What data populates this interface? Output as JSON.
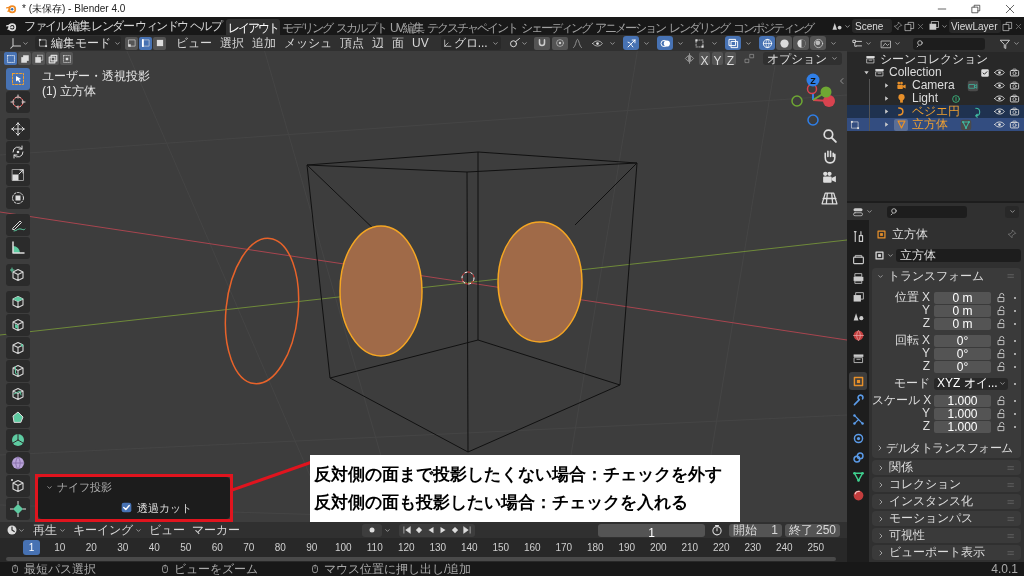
{
  "window": {
    "title": "* (未保存) - Blender 4.0"
  },
  "menu": [
    "ファイル",
    "編集",
    "レンダー",
    "ウィンドウ",
    "ヘルプ"
  ],
  "workspaces": [
    {
      "label": "レイアウト",
      "selected": true
    },
    {
      "label": "モデリング",
      "selected": false
    },
    {
      "label": "スカルプト",
      "selected": false
    },
    {
      "label": "UV編集",
      "selected": false
    },
    {
      "label": "テクスチャペイント",
      "selected": false
    },
    {
      "label": "シェーディング",
      "selected": false
    },
    {
      "label": "アニメーション",
      "selected": false
    },
    {
      "label": "レンダリング",
      "selected": false
    },
    {
      "label": "コンポジティング",
      "selected": false
    }
  ],
  "scene": "Scene",
  "view_layer": "ViewLayer",
  "viewport": {
    "mode": "編集モード",
    "select_modes": [
      {
        "kind": "vertex",
        "selected": false
      },
      {
        "kind": "edge",
        "selected": true
      },
      {
        "kind": "face",
        "selected": false
      }
    ],
    "menus": [
      "ビュー",
      "選択",
      "追加",
      "メッシュ",
      "頂点",
      "辺",
      "面",
      "UV"
    ],
    "orientation": "グロ...",
    "snapping": [
      {
        "kind": "snap",
        "on": false
      },
      {
        "kind": "proportional",
        "on": false
      }
    ],
    "overlays": [
      {
        "kind": "visibility",
        "on": false
      },
      {
        "kind": "gizmo",
        "on": true
      },
      {
        "kind": "overlay",
        "on": true
      },
      {
        "kind": "mesh_overlay",
        "on": false
      },
      {
        "kind": "xray",
        "on": true
      }
    ],
    "shading": [
      {
        "kind": "wireframe",
        "selected": true
      },
      {
        "kind": "solid",
        "selected": false
      },
      {
        "kind": "material",
        "selected": false
      },
      {
        "kind": "rendered",
        "selected": false
      }
    ],
    "box_modes": [
      {
        "kind": "new",
        "selected": true
      },
      {
        "kind": "extend",
        "selected": false
      },
      {
        "kind": "subtract",
        "selected": false
      },
      {
        "kind": "difference",
        "selected": false
      },
      {
        "kind": "intersect",
        "selected": false
      }
    ],
    "mirror_axes": [
      {
        "label": "X",
        "on": false
      },
      {
        "label": "Y",
        "on": false
      },
      {
        "label": "Z",
        "on": false
      }
    ],
    "options": "オプション",
    "view_name": "ユーザー・透視投影",
    "object_info": "(1) 立方体",
    "gizmo_label": "Z",
    "tools": [
      {
        "kind": "select",
        "selected": true
      },
      {
        "kind": "cursor",
        "selected": false
      },
      {
        "kind": "move",
        "selected": false
      },
      {
        "kind": "rotate",
        "selected": false
      },
      {
        "kind": "scale",
        "selected": false
      },
      {
        "kind": "transform",
        "selected": false
      },
      {
        "kind": "annotate",
        "selected": false
      },
      {
        "kind": "measure",
        "selected": false
      },
      {
        "kind": "add_cube",
        "selected": false
      },
      {
        "kind": "extrude",
        "selected": false
      },
      {
        "kind": "inset",
        "selected": false
      },
      {
        "kind": "bevel",
        "selected": false
      },
      {
        "kind": "loop_cut",
        "selected": false
      },
      {
        "kind": "knife",
        "selected": false
      },
      {
        "kind": "poly_build",
        "selected": false
      },
      {
        "kind": "spin",
        "selected": false
      },
      {
        "kind": "smooth",
        "selected": false
      },
      {
        "kind": "edge_slide",
        "selected": false
      },
      {
        "kind": "shrink",
        "selected": false
      }
    ]
  },
  "operator_panel": {
    "title": "ナイフ投影",
    "options": [
      {
        "label": "透過カット",
        "checked": true
      }
    ]
  },
  "annotation": [
    "反対側の面まで投影したくない場合：チェックを外す",
    "反対側の面も投影したい場合：チェックを入れる"
  ],
  "outliner": {
    "root": "シーンコレクション",
    "items": [
      {
        "label": "Collection",
        "kind": "collection",
        "expanded": true,
        "checked": true,
        "children": [
          {
            "label": "Camera",
            "kind": "camera",
            "selected": false,
            "active": false,
            "in_edit_mode": false
          },
          {
            "label": "Light",
            "kind": "light",
            "selected": false,
            "active": false,
            "in_edit_mode": false
          },
          {
            "label": "ベジエ円",
            "kind": "curve",
            "selected": true,
            "active": false,
            "in_edit_mode": false
          },
          {
            "label": "立方体",
            "kind": "mesh",
            "selected": true,
            "active": true,
            "in_edit_mode": true
          }
        ]
      }
    ]
  },
  "properties": {
    "tabs": [
      {
        "kind": "tool",
        "selected": false
      },
      {
        "kind": "render",
        "selected": false
      },
      {
        "kind": "output",
        "selected": false
      },
      {
        "kind": "view_layer",
        "selected": false
      },
      {
        "kind": "scene",
        "selected": false
      },
      {
        "kind": "world",
        "selected": false
      },
      {
        "kind": "collection",
        "selected": false
      },
      {
        "kind": "object",
        "selected": true
      },
      {
        "kind": "modifier",
        "selected": false
      },
      {
        "kind": "particles",
        "selected": false
      },
      {
        "kind": "physics",
        "selected": false
      },
      {
        "kind": "constraints",
        "selected": false
      },
      {
        "kind": "data",
        "selected": false
      },
      {
        "kind": "material",
        "selected": false
      }
    ],
    "object": "立方体",
    "name": "立方体",
    "transform": {
      "title": "トランスフォーム",
      "groups": [
        {
          "kind": "vector",
          "rows": [
            {
              "label": "位置 X",
              "value": "0 m"
            },
            {
              "label": "Y",
              "value": "0 m"
            },
            {
              "label": "Z",
              "value": "0 m"
            }
          ]
        },
        {
          "kind": "vector",
          "rows": [
            {
              "label": "回転 X",
              "value": "0°"
            },
            {
              "label": "Y",
              "value": "0°"
            },
            {
              "label": "Z",
              "value": "0°"
            }
          ]
        },
        {
          "kind": "dropdown",
          "rows": [
            {
              "label": "モード",
              "value": "XYZ オイ..."
            }
          ]
        },
        {
          "kind": "vector",
          "rows": [
            {
              "label": "スケール X",
              "value": "1.000"
            },
            {
              "label": "Y",
              "value": "1.000"
            },
            {
              "label": "Z",
              "value": "1.000"
            }
          ]
        }
      ],
      "subpanel": "デルタトランスフォーム"
    },
    "panels": [
      "関係",
      "コレクション",
      "インスタンス化",
      "モーションパス",
      "可視性",
      "ビューポート表示"
    ]
  },
  "timeline": {
    "menus": [
      "再生",
      "キーイング",
      "ビュー",
      "マーカー"
    ],
    "frame": "1",
    "start_label": "開始",
    "start": "1",
    "end_label": "終了",
    "end": "250",
    "ticks": [
      {
        "label": "1",
        "current": true
      },
      {
        "label": "10",
        "current": false
      },
      {
        "label": "20",
        "current": false
      },
      {
        "label": "30",
        "current": false
      },
      {
        "label": "40",
        "current": false
      },
      {
        "label": "50",
        "current": false
      },
      {
        "label": "60",
        "current": false
      },
      {
        "label": "70",
        "current": false
      },
      {
        "label": "80",
        "current": false
      },
      {
        "label": "90",
        "current": false
      },
      {
        "label": "100",
        "current": false
      },
      {
        "label": "110",
        "current": false
      },
      {
        "label": "120",
        "current": false
      },
      {
        "label": "130",
        "current": false
      },
      {
        "label": "140",
        "current": false
      },
      {
        "label": "150",
        "current": false
      },
      {
        "label": "160",
        "current": false
      },
      {
        "label": "170",
        "current": false
      },
      {
        "label": "180",
        "current": false
      },
      {
        "label": "190",
        "current": false
      },
      {
        "label": "200",
        "current": false
      },
      {
        "label": "210",
        "current": false
      },
      {
        "label": "220",
        "current": false
      },
      {
        "label": "230",
        "current": false
      },
      {
        "label": "240",
        "current": false
      },
      {
        "label": "250",
        "current": false
      }
    ]
  },
  "status_bar": {
    "hints": [
      "最短パス選択",
      "ビューをズーム",
      "マウス位置に押し出し/追加"
    ],
    "version": "4.0.1"
  }
}
